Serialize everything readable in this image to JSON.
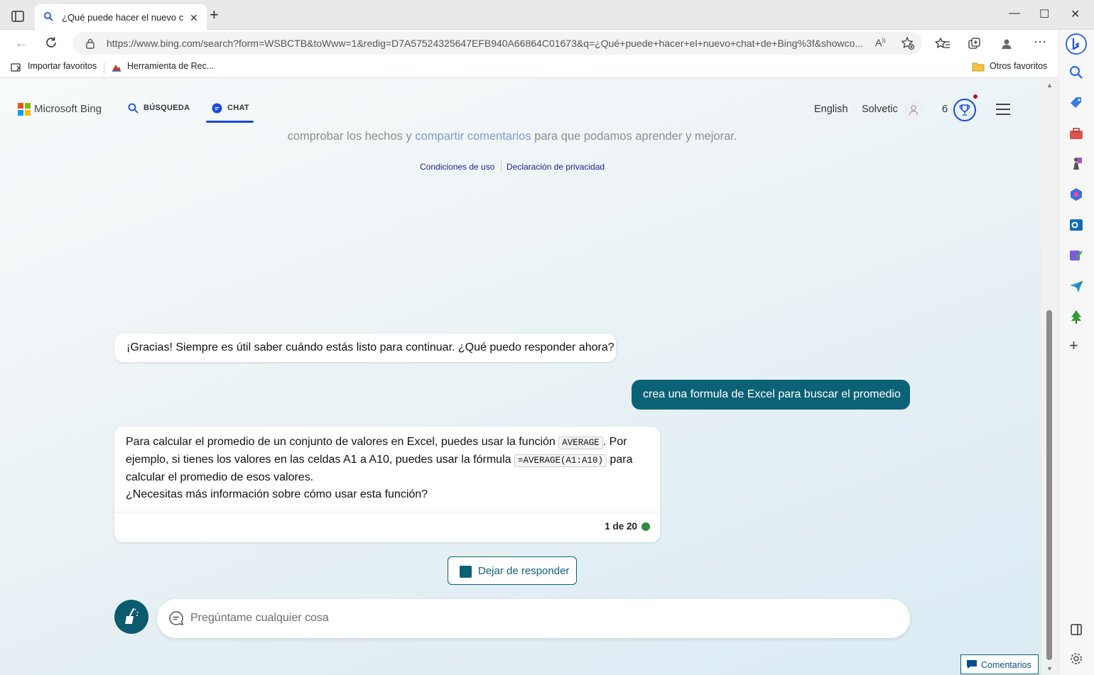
{
  "browser": {
    "tab_title": "¿Qué puede hacer el nuevo chat de Bing?",
    "url": "https://www.bing.com/search?form=WSBCTB&toWww=1&redig=D7A57524325647EFB940A66864C01673&q=¿Qué+puede+hacer+el+nuevo+chat+de+Bing%3f&showco...",
    "favorites": [
      "Importar favoritos",
      "Herramienta de Rec..."
    ],
    "other_favorites": "Otros favoritos"
  },
  "header": {
    "brand": "Microsoft Bing",
    "nav_search": "BÚSQUEDA",
    "nav_chat": "CHAT",
    "language": "English",
    "user": "Solvetic",
    "rewards_count": "6"
  },
  "disclaimer": {
    "prefix": "comprobar los hechos y ",
    "link": "compartir comentarios",
    "suffix": " para que podamos aprender y mejorar."
  },
  "legal": {
    "terms": "Condiciones de uso",
    "privacy": "Declaración de privacidad"
  },
  "messages": {
    "bot1": "¡Gracias! Siempre es útil saber cuándo estás listo para continuar. ¿Qué puedo responder ahora?",
    "user1": "crea una formula de Excel para buscar el promedio",
    "bot2": {
      "part1": "Para calcular el promedio de un conjunto de valores en Excel, puedes usar la función ",
      "code1": "AVERAGE",
      "part2": ". Por ejemplo, si tienes los valores en las celdas A1 a A10, puedes usar la fórmula ",
      "code2": "=AVERAGE(A1:A10)",
      "part3": " para calcular el promedio de esos valores.",
      "question": "¿Necesitas más información sobre cómo usar esta función?",
      "counter": "1 de 20"
    }
  },
  "stop_button": "Dejar de responder",
  "input": {
    "placeholder": "Pregúntame cualquier cosa"
  },
  "feedback": "Comentarios",
  "colors": {
    "accent": "#0b6276",
    "bing_blue": "#174ae4",
    "status_green": "#2e8b3e"
  }
}
